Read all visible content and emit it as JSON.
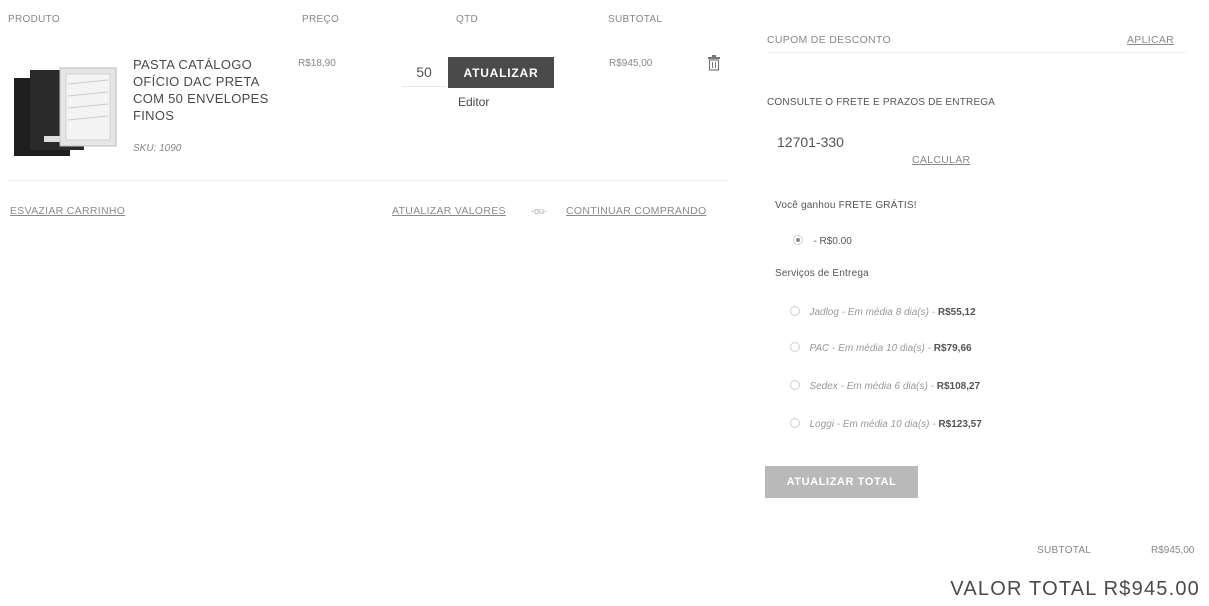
{
  "cart": {
    "headers": {
      "product": "PRODUTO",
      "price": "PREÇO",
      "qty": "QTD",
      "subtotal": "SUBTOTAL"
    },
    "item": {
      "name_lines": [
        "PASTA CATÁLOGO",
        "OFÍCIO DAC PRETA",
        "COM 50 ENVELOPES",
        "FINOS"
      ],
      "sku": "SKU: 1090",
      "price": "R$18,90",
      "qty": "50",
      "update_button": "ATUALIZAR",
      "editor_label": "Editor",
      "subtotal": "R$945,00",
      "delete_icon": "trash-icon"
    },
    "actions": {
      "empty_cart": "ESVAZIAR CARRINHO",
      "update_values": "ATUALIZAR VALORES",
      "or": "-ou-",
      "continue_shopping": "CONTINUAR COMPRANDO"
    }
  },
  "sidebar": {
    "coupon_label": "CUPOM DE DESCONTO",
    "coupon_apply": "APLICAR",
    "shipping_title": "CONSULTE O FRETE E PRAZOS DE ENTREGA",
    "zip_value": "12701-330",
    "calculate": "CALCULAR",
    "free_shipping_title": "Você ganhou FRETE GRÁTIS!",
    "free_option": "- R$0.00",
    "services_title": "Serviços de Entrega",
    "services": [
      {
        "name": "Jadlog",
        "eta": " - Em média 8 dia(s) - ",
        "price": "R$55,12"
      },
      {
        "name": "PAC",
        "eta": " - Em média 10 dia(s) - ",
        "price": "R$79,66"
      },
      {
        "name": "Sedex",
        "eta": " - Em média 6 dia(s) - ",
        "price": "R$108,27"
      },
      {
        "name": "Loggi",
        "eta": " - Em média 10 dia(s) - ",
        "price": "R$123,57"
      }
    ],
    "update_total": "ATUALIZAR TOTAL"
  },
  "totals": {
    "subtotal_label": "SUBTOTAL",
    "subtotal_value": "R$945,00",
    "total_label": "VALOR TOTAL",
    "total_value": "R$945.00"
  }
}
